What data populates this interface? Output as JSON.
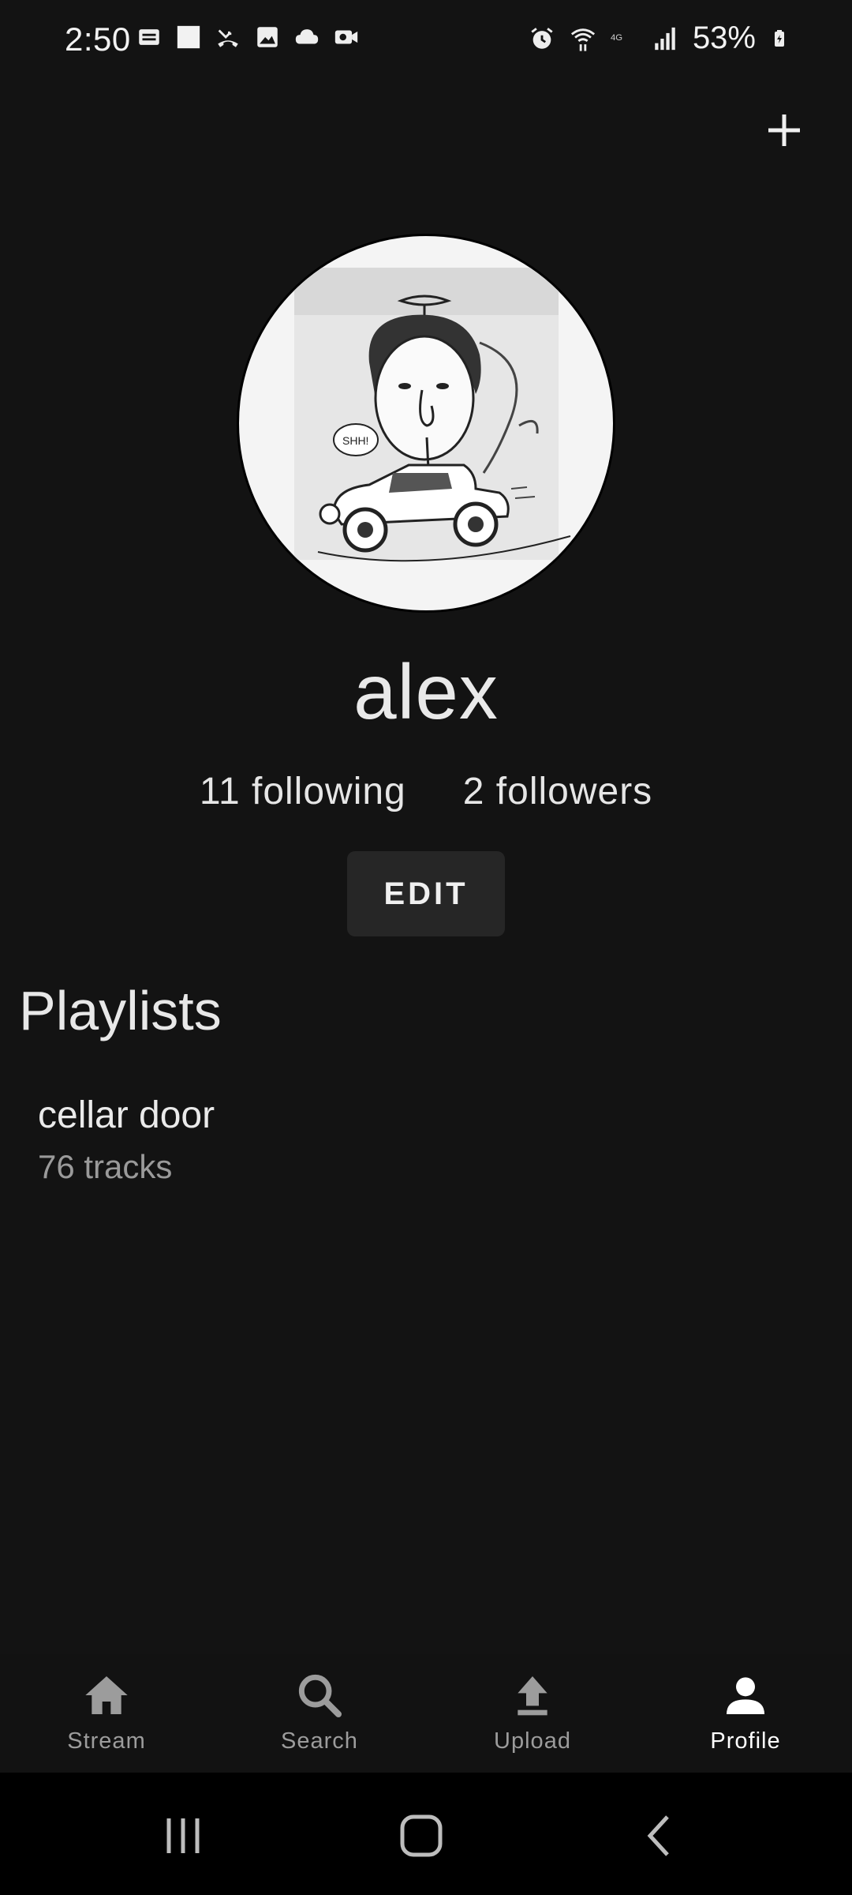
{
  "status_bar": {
    "time": "2:50",
    "battery": "53%",
    "left_icons": [
      "news-icon",
      "square-icon",
      "missed-call-icon",
      "gallery-icon",
      "cloud-icon",
      "video-icon"
    ],
    "right_icons": [
      "alarm-icon",
      "wifi-icon",
      "4g-signal-icon",
      "cellular-signal-icon",
      "battery-charging-icon"
    ]
  },
  "header": {
    "add_icon": "plus-icon"
  },
  "profile": {
    "avatar": "caricature-avatar",
    "name": "alex",
    "following": "11 following",
    "followers": "2 followers",
    "edit_label": "EDIT"
  },
  "playlists": {
    "title": "Playlists",
    "items": [
      {
        "name": "cellar door",
        "tracks": "76 tracks"
      }
    ]
  },
  "bottom_nav": {
    "items": [
      {
        "label": "Stream",
        "icon": "home-icon"
      },
      {
        "label": "Search",
        "icon": "search-icon"
      },
      {
        "label": "Upload",
        "icon": "upload-icon"
      },
      {
        "label": "Profile",
        "icon": "person-icon"
      }
    ],
    "active": "Profile"
  },
  "colors": {
    "background": "#131313",
    "button": "#262626",
    "text_primary": "#e6e6e6",
    "text_secondary": "#9a9a9a"
  }
}
